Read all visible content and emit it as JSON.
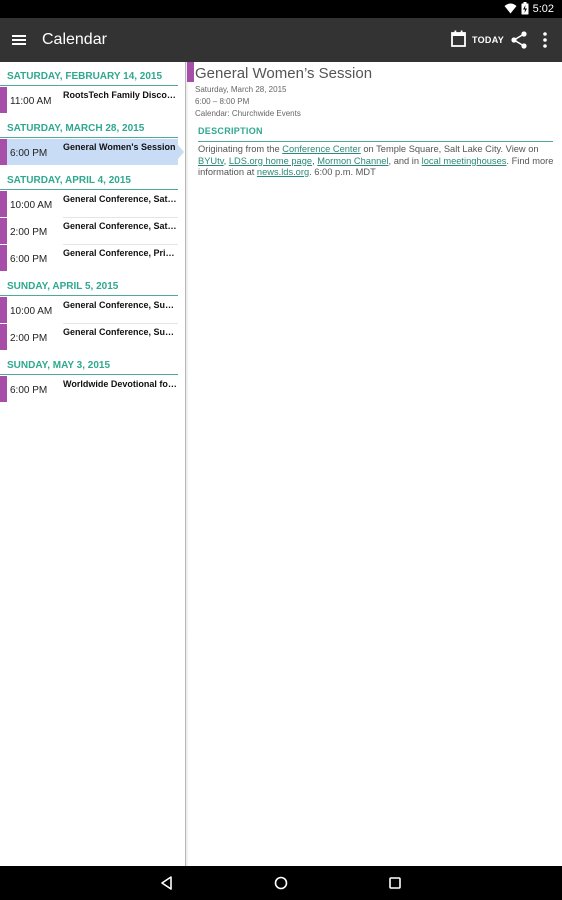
{
  "status_bar": {
    "time": "5:02",
    "icons": [
      "wifi-icon",
      "battery-charging-icon"
    ]
  },
  "app_bar": {
    "title": "Calendar",
    "today_label": "TODAY",
    "icons": [
      "menu-icon",
      "calendar-today-icon",
      "share-icon",
      "overflow-menu-icon"
    ]
  },
  "agenda": [
    {
      "date": "SATURDAY, FEBRUARY 14, 2015",
      "events": [
        {
          "time": "11:00 AM",
          "title": "RootsTech Family Discovery Day"
        }
      ]
    },
    {
      "date": "SATURDAY, MARCH 28, 2015",
      "events": [
        {
          "time": "6:00 PM",
          "title": "General Women's Session",
          "selected": true
        }
      ]
    },
    {
      "date": "SATURDAY, APRIL 4, 2015",
      "events": [
        {
          "time": "10:00 AM",
          "title": "General Conference, Saturday Morning"
        },
        {
          "time": "2:00 PM",
          "title": "General Conference, Saturday Afternoon"
        },
        {
          "time": "6:00 PM",
          "title": "General Conference, Priesthood Session"
        }
      ]
    },
    {
      "date": "SUNDAY, APRIL 5, 2015",
      "events": [
        {
          "time": "10:00 AM",
          "title": "General Conference, Sunday Morning"
        },
        {
          "time": "2:00 PM",
          "title": "General Conference, Sunday Afternoon"
        }
      ]
    },
    {
      "date": "SUNDAY, MAY 3, 2015",
      "events": [
        {
          "time": "6:00 PM",
          "title": "Worldwide Devotional for Young Adults"
        }
      ]
    }
  ],
  "detail": {
    "title": "General Women’s Session",
    "date": "Saturday, March 28, 2015",
    "time_range": "6:00 – 8:00 PM",
    "calendar": "Calendar: Churchwide Events",
    "section_label": "DESCRIPTION",
    "description": {
      "t1": "Originating from the ",
      "l1": "Conference Center",
      "t2": " on Temple Square, Salt Lake City. View on ",
      "l2": "BYUtv",
      "t3": ", ",
      "l3": "LDS.org home page",
      "t4": ", ",
      "l4": "Mormon Channel",
      "t5": ", and in ",
      "l5": "local meetinghouses",
      "t6": ". Find more information at ",
      "l6": "news.lds.org",
      "t7": ". 6:00 p.m. MDT"
    }
  },
  "nav_bar": {
    "icons": [
      "back-icon",
      "home-icon",
      "recents-icon"
    ]
  },
  "colors": {
    "accent_purple": "#a64ea8",
    "header_teal": "#2fa88f",
    "app_bar": "#333333",
    "selected_bg": "#c8dcf5"
  }
}
